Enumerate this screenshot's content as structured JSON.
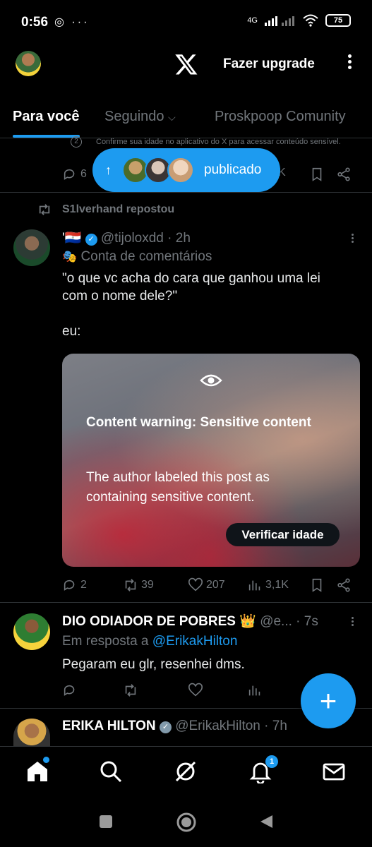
{
  "status_bar": {
    "time": "0:56",
    "network": "4G",
    "battery": "75"
  },
  "header": {
    "upgrade_label": "Fazer upgrade"
  },
  "tabs": [
    {
      "label": "Para você"
    },
    {
      "label": "Seguindo"
    },
    {
      "label": "Proskpoop Comunity"
    }
  ],
  "top_post": {
    "notice": "Confirme sua idade no aplicativo do X para acessar conteúdo sensível.",
    "replies": "6",
    "views_suffix": "K"
  },
  "new_posts_pill": {
    "label": "publicado"
  },
  "repost_post": {
    "repost_label": "S1lverhand repostou",
    "flag": "🇵🇾",
    "handle": "@tijoloxdd",
    "time": "· 2h",
    "account_label": "Conta de comentários",
    "text_line1": "\"o que vc acha do cara que ganhou uma lei",
    "text_line2": "com o nome dele?\"",
    "text_line3": "eu:",
    "warning_title": "Content warning: Sensitive content",
    "warning_body": "The author labeled this post as containing sensitive content.",
    "verify_label": "Verificar idade",
    "replies": "2",
    "reposts": "39",
    "likes": "207",
    "views": "3,1K"
  },
  "reply_post": {
    "name": "DIO ODIADOR DE POBRES 👑",
    "handle": "@e...",
    "time": "· 7s",
    "reply_prefix": "Em resposta a",
    "reply_to": "@ErikakHilton",
    "text": "Pegaram eu glr, resenhei dms."
  },
  "erika_post": {
    "name": "ERIKA HILTON",
    "handle": "@ErikakHilton",
    "time": "· 7h"
  },
  "notifications_badge": "1"
}
